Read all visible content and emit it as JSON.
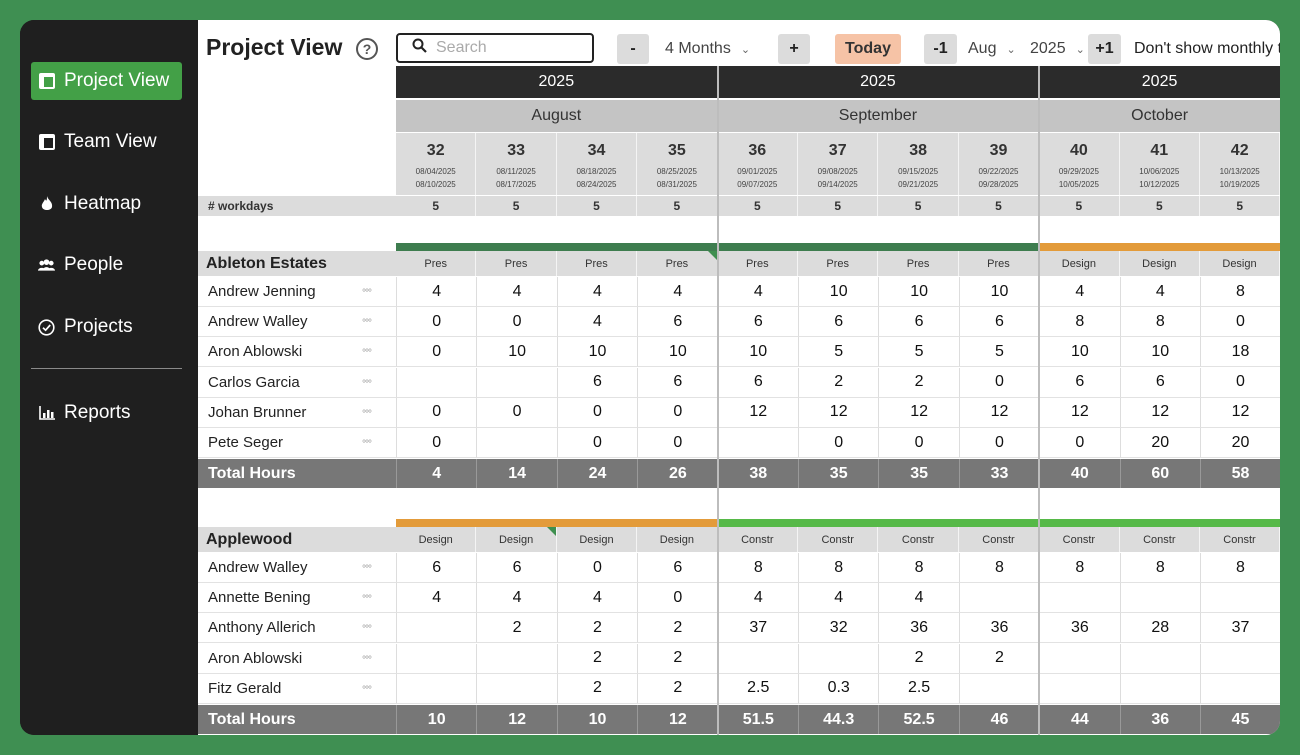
{
  "sidebar": {
    "items": [
      {
        "label": "Project View",
        "icon": "table-icon"
      },
      {
        "label": "Team View",
        "icon": "table-icon"
      },
      {
        "label": "Heatmap",
        "icon": "flame-icon"
      },
      {
        "label": "People",
        "icon": "people-icon"
      },
      {
        "label": "Projects",
        "icon": "check-circle-icon"
      },
      {
        "label": "Reports",
        "icon": "bar-chart-icon"
      }
    ]
  },
  "toolbar": {
    "title": "Project View",
    "help": "?",
    "search_placeholder": "Search",
    "minus": "-",
    "range": "4 Months",
    "plus": "+",
    "today": "Today",
    "prev": "-1",
    "month": "Aug",
    "year": "2025",
    "next": "+1",
    "notice": "Don't show monthly t"
  },
  "colors": {
    "accent": "#43a047",
    "phase_pres": "#3e7d4f",
    "phase_design": "#e39b3a",
    "phase_constr": "#56b948"
  },
  "grid": {
    "months": [
      {
        "year": "2025",
        "name": "August"
      },
      {
        "year": "2025",
        "name": "September"
      },
      {
        "year": "2025",
        "name": "October"
      }
    ],
    "workdays_label": "# workdays",
    "weeks": [
      {
        "num": "32",
        "start": "08/04/2025",
        "end": "08/10/2025",
        "workdays": "5"
      },
      {
        "num": "33",
        "start": "08/11/2025",
        "end": "08/17/2025",
        "workdays": "5"
      },
      {
        "num": "34",
        "start": "08/18/2025",
        "end": "08/24/2025",
        "workdays": "5"
      },
      {
        "num": "35",
        "start": "08/25/2025",
        "end": "08/31/2025",
        "workdays": "5"
      },
      {
        "num": "36",
        "start": "09/01/2025",
        "end": "09/07/2025",
        "workdays": "5"
      },
      {
        "num": "37",
        "start": "09/08/2025",
        "end": "09/14/2025",
        "workdays": "5"
      },
      {
        "num": "38",
        "start": "09/15/2025",
        "end": "09/21/2025",
        "workdays": "5"
      },
      {
        "num": "39",
        "start": "09/22/2025",
        "end": "09/28/2025",
        "workdays": "5"
      },
      {
        "num": "40",
        "start": "09/29/2025",
        "end": "10/05/2025",
        "workdays": "5"
      },
      {
        "num": "41",
        "start": "10/06/2025",
        "end": "10/12/2025",
        "workdays": "5"
      },
      {
        "num": "42",
        "start": "10/13/2025",
        "end": "10/19/2025",
        "workdays": "5"
      }
    ]
  },
  "projects": [
    {
      "name": "Ableton Estates",
      "phases": [
        "Pres",
        "Pres",
        "Pres",
        "Pres",
        "Pres",
        "Pres",
        "Pres",
        "Pres",
        "Design",
        "Design",
        "Design"
      ],
      "phase_colors": [
        "#3e7d4f",
        "#3e7d4f",
        "#3e7d4f",
        "#3e7d4f",
        "#3e7d4f",
        "#3e7d4f",
        "#3e7d4f",
        "#3e7d4f",
        "#e39b3a",
        "#e39b3a",
        "#e39b3a"
      ],
      "people": [
        {
          "name": "Andrew Jenning",
          "hours": [
            "4",
            "4",
            "4",
            "4",
            "4",
            "10",
            "10",
            "10",
            "4",
            "4",
            "8"
          ]
        },
        {
          "name": "Andrew Walley",
          "hours": [
            "0",
            "0",
            "4",
            "6",
            "6",
            "6",
            "6",
            "6",
            "8",
            "8",
            "0"
          ]
        },
        {
          "name": "Aron Ablowski",
          "hours": [
            "0",
            "10",
            "10",
            "10",
            "10",
            "5",
            "5",
            "5",
            "10",
            "10",
            "18"
          ]
        },
        {
          "name": "Carlos Garcia",
          "hours": [
            "",
            "",
            "6",
            "6",
            "6",
            "2",
            "2",
            "0",
            "6",
            "6",
            "0"
          ]
        },
        {
          "name": "Johan Brunner",
          "hours": [
            "0",
            "0",
            "0",
            "0",
            "12",
            "12",
            "12",
            "12",
            "12",
            "12",
            "12"
          ]
        },
        {
          "name": "Pete Seger",
          "hours": [
            "0",
            "",
            "0",
            "0",
            "",
            "0",
            "0",
            "0",
            "0",
            "20",
            "20"
          ]
        }
      ],
      "total_label": "Total Hours",
      "totals": [
        "4",
        "14",
        "24",
        "26",
        "38",
        "35",
        "35",
        "33",
        "40",
        "60",
        "58"
      ]
    },
    {
      "name": "Applewood",
      "phases": [
        "Design",
        "Design",
        "Design",
        "Design",
        "Constr",
        "Constr",
        "Constr",
        "Constr",
        "Constr",
        "Constr",
        "Constr"
      ],
      "phase_colors": [
        "#e39b3a",
        "#e39b3a",
        "#e39b3a",
        "#e39b3a",
        "#56b948",
        "#56b948",
        "#56b948",
        "#56b948",
        "#56b948",
        "#56b948",
        "#56b948"
      ],
      "people": [
        {
          "name": "Andrew Walley",
          "hours": [
            "6",
            "6",
            "0",
            "6",
            "8",
            "8",
            "8",
            "8",
            "8",
            "8",
            "8"
          ]
        },
        {
          "name": "Annette Bening",
          "hours": [
            "4",
            "4",
            "4",
            "0",
            "4",
            "4",
            "4",
            "",
            "",
            "",
            ""
          ]
        },
        {
          "name": "Anthony Allerich",
          "hours": [
            "",
            "2",
            "2",
            "2",
            "37",
            "32",
            "36",
            "36",
            "36",
            "28",
            "37"
          ]
        },
        {
          "name": "Aron Ablowski",
          "hours": [
            "",
            "",
            "2",
            "2",
            "",
            "",
            "2",
            "2",
            "",
            "",
            ""
          ]
        },
        {
          "name": "Fitz Gerald",
          "hours": [
            "",
            "",
            "2",
            "2",
            "2.5",
            "0.3",
            "2.5",
            "",
            "",
            "",
            ""
          ]
        }
      ],
      "total_label": "Total Hours",
      "totals": [
        "10",
        "12",
        "10",
        "12",
        "51.5",
        "44.3",
        "52.5",
        "46",
        "44",
        "36",
        "45"
      ]
    }
  ]
}
